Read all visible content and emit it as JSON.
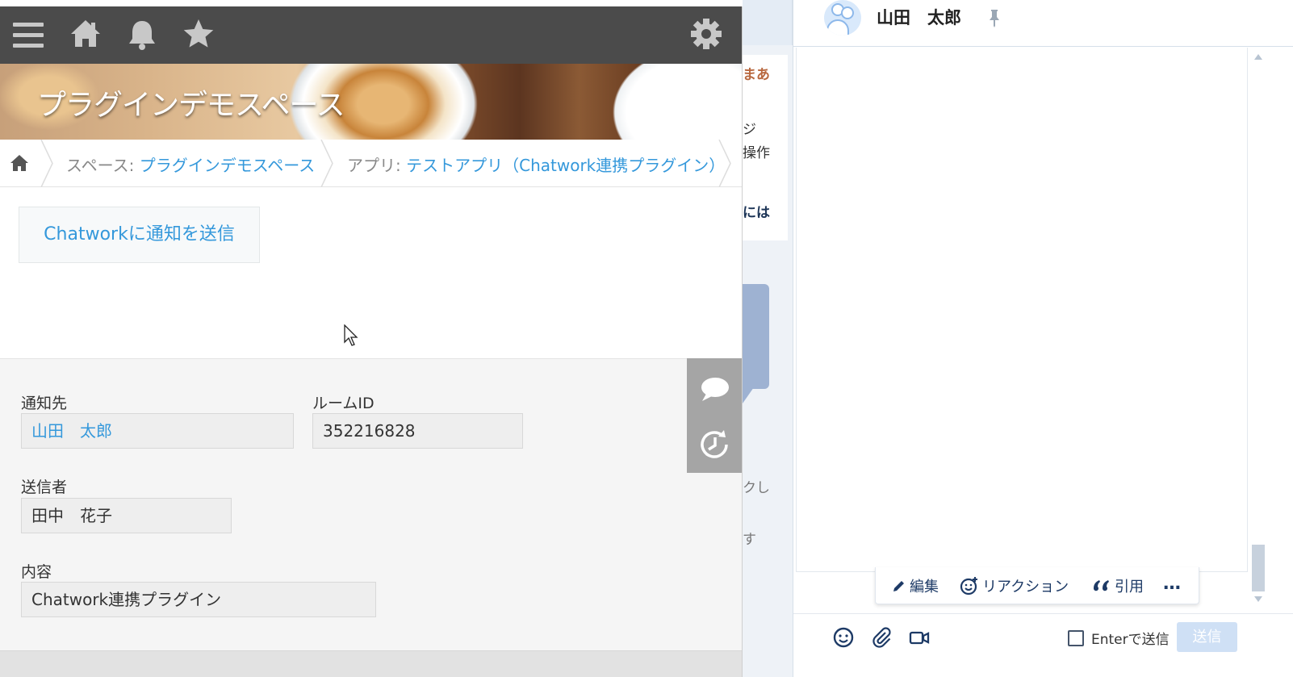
{
  "chatwork": {
    "room_name": "山田　太郎",
    "background_fragments": [
      "まあ",
      "ジ",
      "操作",
      "には",
      "クし",
      "す"
    ],
    "message_text": "-",
    "actions": {
      "edit": "編集",
      "reaction": "リアクション",
      "quote": "引用",
      "more": "…"
    },
    "enter_to_send_label": "Enterで送信",
    "send_button": "送信",
    "icons": [
      "emoji-icon",
      "paperclip-icon",
      "video-icon",
      "pin-icon"
    ]
  },
  "kintone": {
    "icons": [
      "menu-icon",
      "home-icon",
      "bell-icon",
      "star-icon",
      "gear-icon"
    ],
    "space_title": "プラグインデモスペース",
    "breadcrumb": {
      "space_label": "スペース: ",
      "space_name": "プラグインデモスペース",
      "app_label": "アプリ: ",
      "app_name": "テストアプリ（Chatwork連携プラグイン）"
    },
    "send_button": "Chatworkに通知を送信",
    "form": {
      "recipient_label": "通知先",
      "recipient_value": "山田　太郎",
      "room_id_label": "ルームID",
      "room_id_value": "352216828",
      "sender_label": "送信者",
      "sender_value": "田中　花子",
      "content_label": "内容",
      "content_value": "Chatwork連携プラグイン"
    },
    "colors": {
      "topbar": "#4b4b4b",
      "link": "#3498db",
      "form_bg": "#f5f5f5",
      "sidebar": "#a5a5a5"
    }
  }
}
